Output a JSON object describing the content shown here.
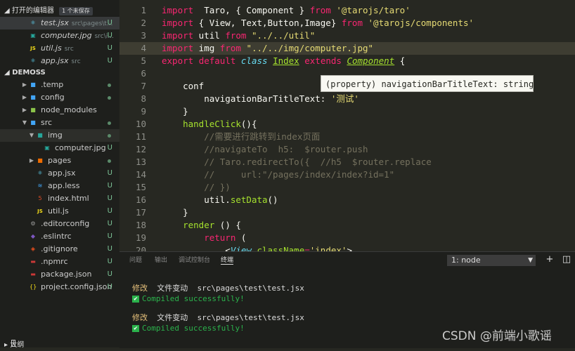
{
  "sidebar": {
    "open_editors": {
      "title": "打开的编辑器",
      "badge": "1 个未保存"
    },
    "open_files": [
      {
        "name": "test.jsx",
        "path": "src\\pages\\t...",
        "status": "U",
        "icon": "react-icon",
        "color": "#61dafb"
      },
      {
        "name": "computer.jpg",
        "path": "src\\i...",
        "status": "U",
        "icon": "image-icon",
        "color": "#26a69a"
      },
      {
        "name": "util.js",
        "path": "src",
        "status": "U",
        "icon": "js-icon",
        "color": "#f5de19"
      },
      {
        "name": "app.jsx",
        "path": "src",
        "status": "U",
        "icon": "react-icon",
        "color": "#61dafb"
      }
    ],
    "project": {
      "title": "DEMOSS"
    },
    "tree": [
      {
        "name": ".temp",
        "status": "dot",
        "icon": "folder-icon",
        "color": "#42a5f5",
        "twisty": "▶"
      },
      {
        "name": "config",
        "status": "dot",
        "icon": "folder-icon",
        "color": "#42a5f5",
        "twisty": "▶"
      },
      {
        "name": "node_modules",
        "status": "",
        "icon": "folder-icon",
        "color": "#8bc34a",
        "twisty": "▶"
      },
      {
        "name": "src",
        "status": "dot",
        "icon": "folder-icon",
        "color": "#42a5f5",
        "twisty": "▼"
      },
      {
        "name": "img",
        "status": "dot",
        "icon": "folder-icon",
        "color": "#26a69a",
        "twisty": "▼"
      },
      {
        "name": "computer.jpg",
        "status": "U",
        "icon": "image-icon",
        "color": "#26a69a",
        "twisty": ""
      },
      {
        "name": "pages",
        "status": "dot",
        "icon": "folder-icon",
        "color": "#ef6c00",
        "twisty": "▶"
      },
      {
        "name": "app.jsx",
        "status": "U",
        "icon": "react-icon",
        "color": "#61dafb",
        "twisty": ""
      },
      {
        "name": "app.less",
        "status": "U",
        "icon": "less-icon",
        "color": "#42a5f5",
        "twisty": ""
      },
      {
        "name": "index.html",
        "status": "U",
        "icon": "html-icon",
        "color": "#e44d26",
        "twisty": ""
      },
      {
        "name": "util.js",
        "status": "U",
        "icon": "js-icon",
        "color": "#f5de19",
        "twisty": ""
      },
      {
        "name": ".editorconfig",
        "status": "U",
        "icon": "gear-icon",
        "color": "#9e9e9e",
        "twisty": ""
      },
      {
        "name": ".eslintrc",
        "status": "U",
        "icon": "eslint-icon",
        "color": "#7e57c2",
        "twisty": ""
      },
      {
        "name": ".gitignore",
        "status": "U",
        "icon": "git-icon",
        "color": "#f4511e",
        "twisty": ""
      },
      {
        "name": ".npmrc",
        "status": "U",
        "icon": "npm-icon",
        "color": "#cb3837",
        "twisty": ""
      },
      {
        "name": "package.json",
        "status": "U",
        "icon": "npm-icon",
        "color": "#cb3837",
        "twisty": ""
      },
      {
        "name": "project.config.json",
        "status": "U",
        "icon": "json-icon",
        "color": "#f5de19",
        "twisty": ""
      }
    ],
    "outline": {
      "title": "大纲"
    }
  },
  "editor": {
    "tooltip": "(property) navigationBarTitleText: string",
    "lines": [
      {
        "n": "1",
        "segs": [
          [
            "k",
            "import"
          ],
          [
            "",
            "  Taro, { Component } "
          ],
          [
            "k",
            "from"
          ],
          [
            "",
            " "
          ],
          [
            "s",
            "'@tarojs/taro'"
          ]
        ]
      },
      {
        "n": "2",
        "segs": [
          [
            "k",
            "import"
          ],
          [
            "",
            " { View, Text,Button,Image} "
          ],
          [
            "k",
            "from"
          ],
          [
            "",
            " "
          ],
          [
            "s",
            "'@tarojs/components'"
          ]
        ]
      },
      {
        "n": "3",
        "segs": [
          [
            "k",
            "import"
          ],
          [
            "",
            " util "
          ],
          [
            "k",
            "from"
          ],
          [
            "",
            " "
          ],
          [
            "s",
            "\"../../util\""
          ]
        ]
      },
      {
        "n": "4",
        "segs": [
          [
            "k",
            "import"
          ],
          [
            "",
            " img "
          ],
          [
            "k",
            "from"
          ],
          [
            "",
            " "
          ],
          [
            "s",
            "\"../../img/computer.jpg\""
          ]
        ]
      },
      {
        "n": "5",
        "segs": [
          [
            "k",
            "export"
          ],
          [
            "",
            " "
          ],
          [
            "k",
            "default"
          ],
          [
            "",
            " "
          ],
          [
            "it",
            "class"
          ],
          [
            "",
            " "
          ],
          [
            "gu",
            "Index"
          ],
          [
            "",
            " "
          ],
          [
            "k",
            "extends"
          ],
          [
            "",
            " "
          ],
          [
            "gi",
            "Component"
          ],
          [
            "",
            " {"
          ]
        ]
      },
      {
        "n": "6",
        "segs": []
      },
      {
        "n": "7",
        "segs": [
          [
            "",
            "    conf"
          ]
        ]
      },
      {
        "n": "8",
        "segs": [
          [
            "",
            "        navigationBarTitleText: "
          ],
          [
            "s",
            "'测试'"
          ]
        ]
      },
      {
        "n": "9",
        "segs": [
          [
            "",
            "    }"
          ]
        ]
      },
      {
        "n": "10",
        "segs": [
          [
            "f",
            "    handleClick"
          ],
          [
            "",
            "(){"
          ]
        ]
      },
      {
        "n": "11",
        "segs": [
          [
            "c",
            "        //需要进行跳转到index页面"
          ]
        ]
      },
      {
        "n": "12",
        "segs": [
          [
            "c",
            "        //navigateTo  h5:  $router.push"
          ]
        ]
      },
      {
        "n": "13",
        "segs": [
          [
            "c",
            "        // Taro.redirectTo({  //h5  $router.replace"
          ]
        ]
      },
      {
        "n": "14",
        "segs": [
          [
            "c",
            "        //     url:\"/pages/index/index?id=1\""
          ]
        ]
      },
      {
        "n": "15",
        "segs": [
          [
            "c",
            "        // })"
          ]
        ]
      },
      {
        "n": "16",
        "segs": [
          [
            "",
            "        util."
          ],
          [
            "f",
            "setData"
          ],
          [
            "",
            "()"
          ]
        ]
      },
      {
        "n": "17",
        "segs": [
          [
            "",
            "    }"
          ]
        ]
      },
      {
        "n": "18",
        "segs": [
          [
            "f",
            "    render"
          ],
          [
            "",
            " () {"
          ]
        ]
      },
      {
        "n": "19",
        "segs": [
          [
            "k",
            "        return"
          ],
          [
            "",
            " ("
          ]
        ]
      },
      {
        "n": "20",
        "segs": [
          [
            "",
            "            <"
          ],
          [
            "it",
            "View"
          ],
          [
            "",
            " "
          ],
          [
            "f",
            "className"
          ],
          [
            "k",
            "="
          ],
          [
            "s",
            "'index'"
          ],
          [
            "",
            ">"
          ]
        ]
      }
    ]
  },
  "panel": {
    "tabs": [
      "问题",
      "输出",
      "调试控制台",
      "终端"
    ],
    "active_tab": "终端",
    "terminal_select": "1: node",
    "buttons": {
      "add": "+",
      "split": "◫"
    },
    "lines": [
      {
        "action": "修改",
        "label": "文件变动",
        "file": "src\\pages\\test\\test.jsx"
      },
      {
        "status": "Compiled successfully!"
      },
      {
        "action": "修改",
        "label": "文件变动",
        "file": "src\\pages\\test\\test.jsx"
      },
      {
        "status": "Compiled successfully!"
      }
    ]
  },
  "watermark": "CSDN @前端小歌谣"
}
